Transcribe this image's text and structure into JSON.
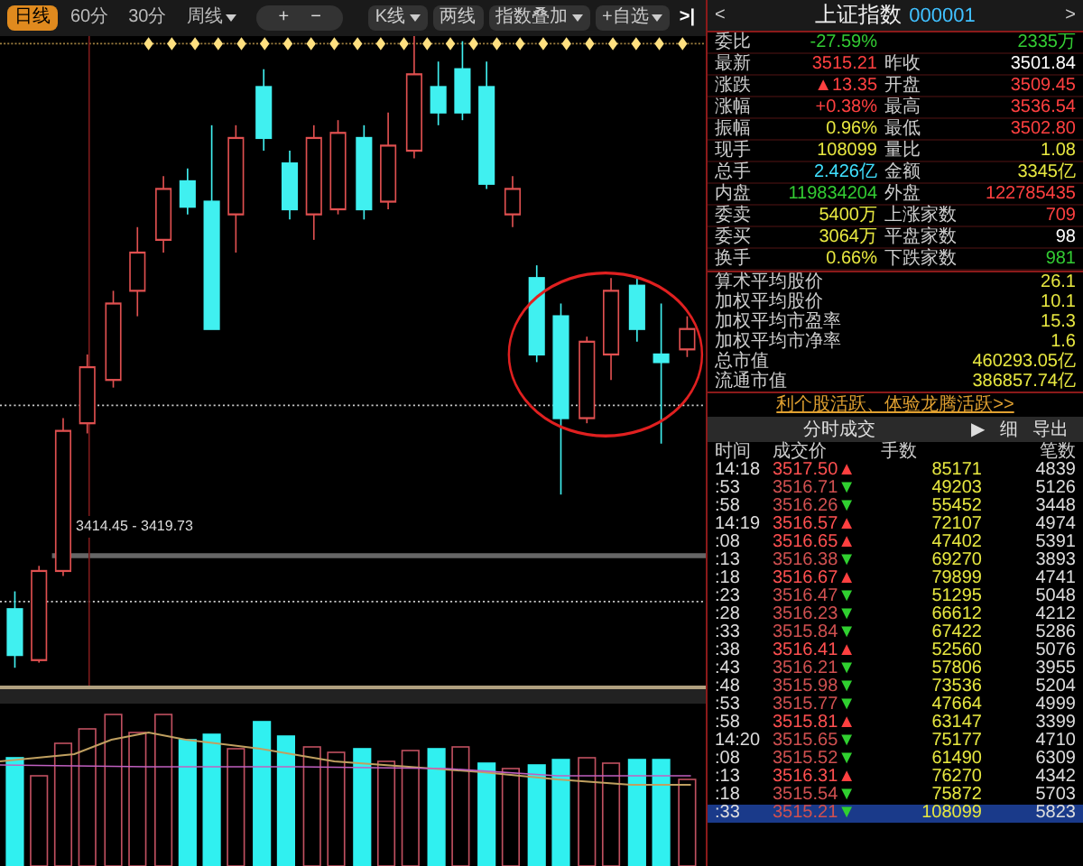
{
  "toolbar": {
    "left_items": [
      {
        "label": "日线",
        "selected": true,
        "dropdown": false
      },
      {
        "label": "60分",
        "selected": false,
        "dropdown": false
      },
      {
        "label": "30分",
        "selected": false,
        "dropdown": false
      },
      {
        "label": "周线",
        "selected": false,
        "dropdown": true
      }
    ],
    "zoom_buttons": [
      "+",
      "−"
    ],
    "right_items": [
      {
        "label": "K线",
        "dropdown": true
      },
      {
        "label": "两线",
        "dropdown": false
      },
      {
        "label": "指数叠加",
        "dropdown": true
      },
      {
        "label": "+自选",
        "dropdown": true
      }
    ],
    "collapse": ">|"
  },
  "chart": {
    "price_band_label": "3414.45 - 3419.73"
  },
  "quote": {
    "prev": "<",
    "title": "上证指数",
    "code": "000001",
    "next": ">",
    "rows": [
      {
        "label": "委比",
        "value": {
          "text": "-27.59%",
          "kind": "down"
        },
        "value2": {
          "text": "2335万",
          "kind": "down"
        }
      },
      {
        "label": "最新",
        "value": {
          "text": "3515.21",
          "kind": "up"
        },
        "label2": "昨收",
        "value2": {
          "text": "3501.84",
          "kind": "flat"
        }
      },
      {
        "label": "涨跌",
        "value": {
          "text": "▲13.35",
          "kind": "up"
        },
        "label2": "开盘",
        "value2": {
          "text": "3509.45",
          "kind": "up"
        }
      },
      {
        "label": "涨幅",
        "value": {
          "text": "+0.38%",
          "kind": "up"
        },
        "label2": "最高",
        "value2": {
          "text": "3536.54",
          "kind": "up"
        }
      },
      {
        "label": "振幅",
        "value": {
          "text": "0.96%",
          "kind": "amount"
        },
        "label2": "最低",
        "value2": {
          "text": "3502.80",
          "kind": "up"
        }
      },
      {
        "label": "现手",
        "value": {
          "text": "108099",
          "kind": "amount"
        },
        "label2": "量比",
        "value2": {
          "text": "1.08",
          "kind": "amount"
        }
      },
      {
        "label": "总手",
        "value": {
          "text": "2.426亿",
          "kind": "volume"
        },
        "label2": "金额",
        "value2": {
          "text": "3345亿",
          "kind": "amount"
        }
      },
      {
        "label": "内盘",
        "value": {
          "text": "119834204",
          "kind": "down"
        },
        "label2": "外盘",
        "value2": {
          "text": "122785435",
          "kind": "up"
        }
      },
      {
        "label": "委卖",
        "value": {
          "text": "5400万",
          "kind": "amount"
        },
        "label2": "上涨家数",
        "value2": {
          "text": "709",
          "kind": "up"
        }
      },
      {
        "label": "委买",
        "value": {
          "text": "3064万",
          "kind": "amount"
        },
        "label2": "平盘家数",
        "value2": {
          "text": "98",
          "kind": "flat"
        }
      },
      {
        "label": "换手",
        "value": {
          "text": "0.66%",
          "kind": "amount"
        },
        "label2": "下跌家数",
        "value2": {
          "text": "981",
          "kind": "down"
        }
      }
    ],
    "stats": [
      {
        "label": "算术平均股价",
        "value": "26.1"
      },
      {
        "label": "加权平均股价",
        "value": "10.1"
      },
      {
        "label": "加权平均市盈率",
        "value": "15.3"
      },
      {
        "label": "加权平均市净率",
        "value": "1.6"
      },
      {
        "label": "总市值",
        "value": "460293.05亿"
      },
      {
        "label": "流通市值",
        "value": "386857.74亿"
      }
    ],
    "promo_link": "利个股活跃、体验龙腾活跃>>"
  },
  "ticks": {
    "title": "分时成交",
    "buttons": [
      "▶",
      "细",
      "导出"
    ],
    "columns": [
      "时间",
      "成交价",
      "手数",
      "笔数"
    ],
    "rows": [
      {
        "time": "14:18",
        "price": "3517.50",
        "arrow": "▲",
        "kind": "up",
        "volume": "85171",
        "count": "4839",
        "selected": false
      },
      {
        "time": ":53",
        "price": "3516.71",
        "arrow": "▼",
        "kind": "down",
        "volume": "49203",
        "count": "5126",
        "selected": false
      },
      {
        "time": ":58",
        "price": "3516.26",
        "arrow": "▼",
        "kind": "down",
        "volume": "55452",
        "count": "3448",
        "selected": false
      },
      {
        "time": "14:19",
        "price": "3516.57",
        "arrow": "▲",
        "kind": "up",
        "volume": "72107",
        "count": "4974",
        "selected": false
      },
      {
        "time": ":08",
        "price": "3516.65",
        "arrow": "▲",
        "kind": "up",
        "volume": "47402",
        "count": "5391",
        "selected": false
      },
      {
        "time": ":13",
        "price": "3516.38",
        "arrow": "▼",
        "kind": "down",
        "volume": "69270",
        "count": "3893",
        "selected": false
      },
      {
        "time": ":18",
        "price": "3516.67",
        "arrow": "▲",
        "kind": "up",
        "volume": "79899",
        "count": "4741",
        "selected": false
      },
      {
        "time": ":23",
        "price": "3516.47",
        "arrow": "▼",
        "kind": "down",
        "volume": "51295",
        "count": "5048",
        "selected": false
      },
      {
        "time": ":28",
        "price": "3516.23",
        "arrow": "▼",
        "kind": "down",
        "volume": "66612",
        "count": "4212",
        "selected": false
      },
      {
        "time": ":33",
        "price": "3515.84",
        "arrow": "▼",
        "kind": "down",
        "volume": "67422",
        "count": "5286",
        "selected": false
      },
      {
        "time": ":38",
        "price": "3516.41",
        "arrow": "▲",
        "kind": "up",
        "volume": "52560",
        "count": "5076",
        "selected": false
      },
      {
        "time": ":43",
        "price": "3516.21",
        "arrow": "▼",
        "kind": "down",
        "volume": "57806",
        "count": "3955",
        "selected": false
      },
      {
        "time": ":48",
        "price": "3515.98",
        "arrow": "▼",
        "kind": "down",
        "volume": "73536",
        "count": "5204",
        "selected": false
      },
      {
        "time": ":53",
        "price": "3515.77",
        "arrow": "▼",
        "kind": "down",
        "volume": "47664",
        "count": "4999",
        "selected": false
      },
      {
        "time": ":58",
        "price": "3515.81",
        "arrow": "▲",
        "kind": "up",
        "volume": "63147",
        "count": "3399",
        "selected": false
      },
      {
        "time": "14:20",
        "price": "3515.65",
        "arrow": "▼",
        "kind": "down",
        "volume": "75177",
        "count": "4710",
        "selected": false
      },
      {
        "time": ":08",
        "price": "3515.52",
        "arrow": "▼",
        "kind": "down",
        "volume": "61490",
        "count": "6309",
        "selected": false
      },
      {
        "time": ":13",
        "price": "3516.31",
        "arrow": "▲",
        "kind": "up",
        "volume": "76270",
        "count": "4342",
        "selected": false
      },
      {
        "time": ":18",
        "price": "3515.54",
        "arrow": "▼",
        "kind": "down",
        "volume": "75872",
        "count": "5703",
        "selected": false
      },
      {
        "time": ":33",
        "price": "3515.21",
        "arrow": "▼",
        "kind": "down",
        "volume": "108099",
        "count": "5823",
        "selected": true
      }
    ]
  }
}
